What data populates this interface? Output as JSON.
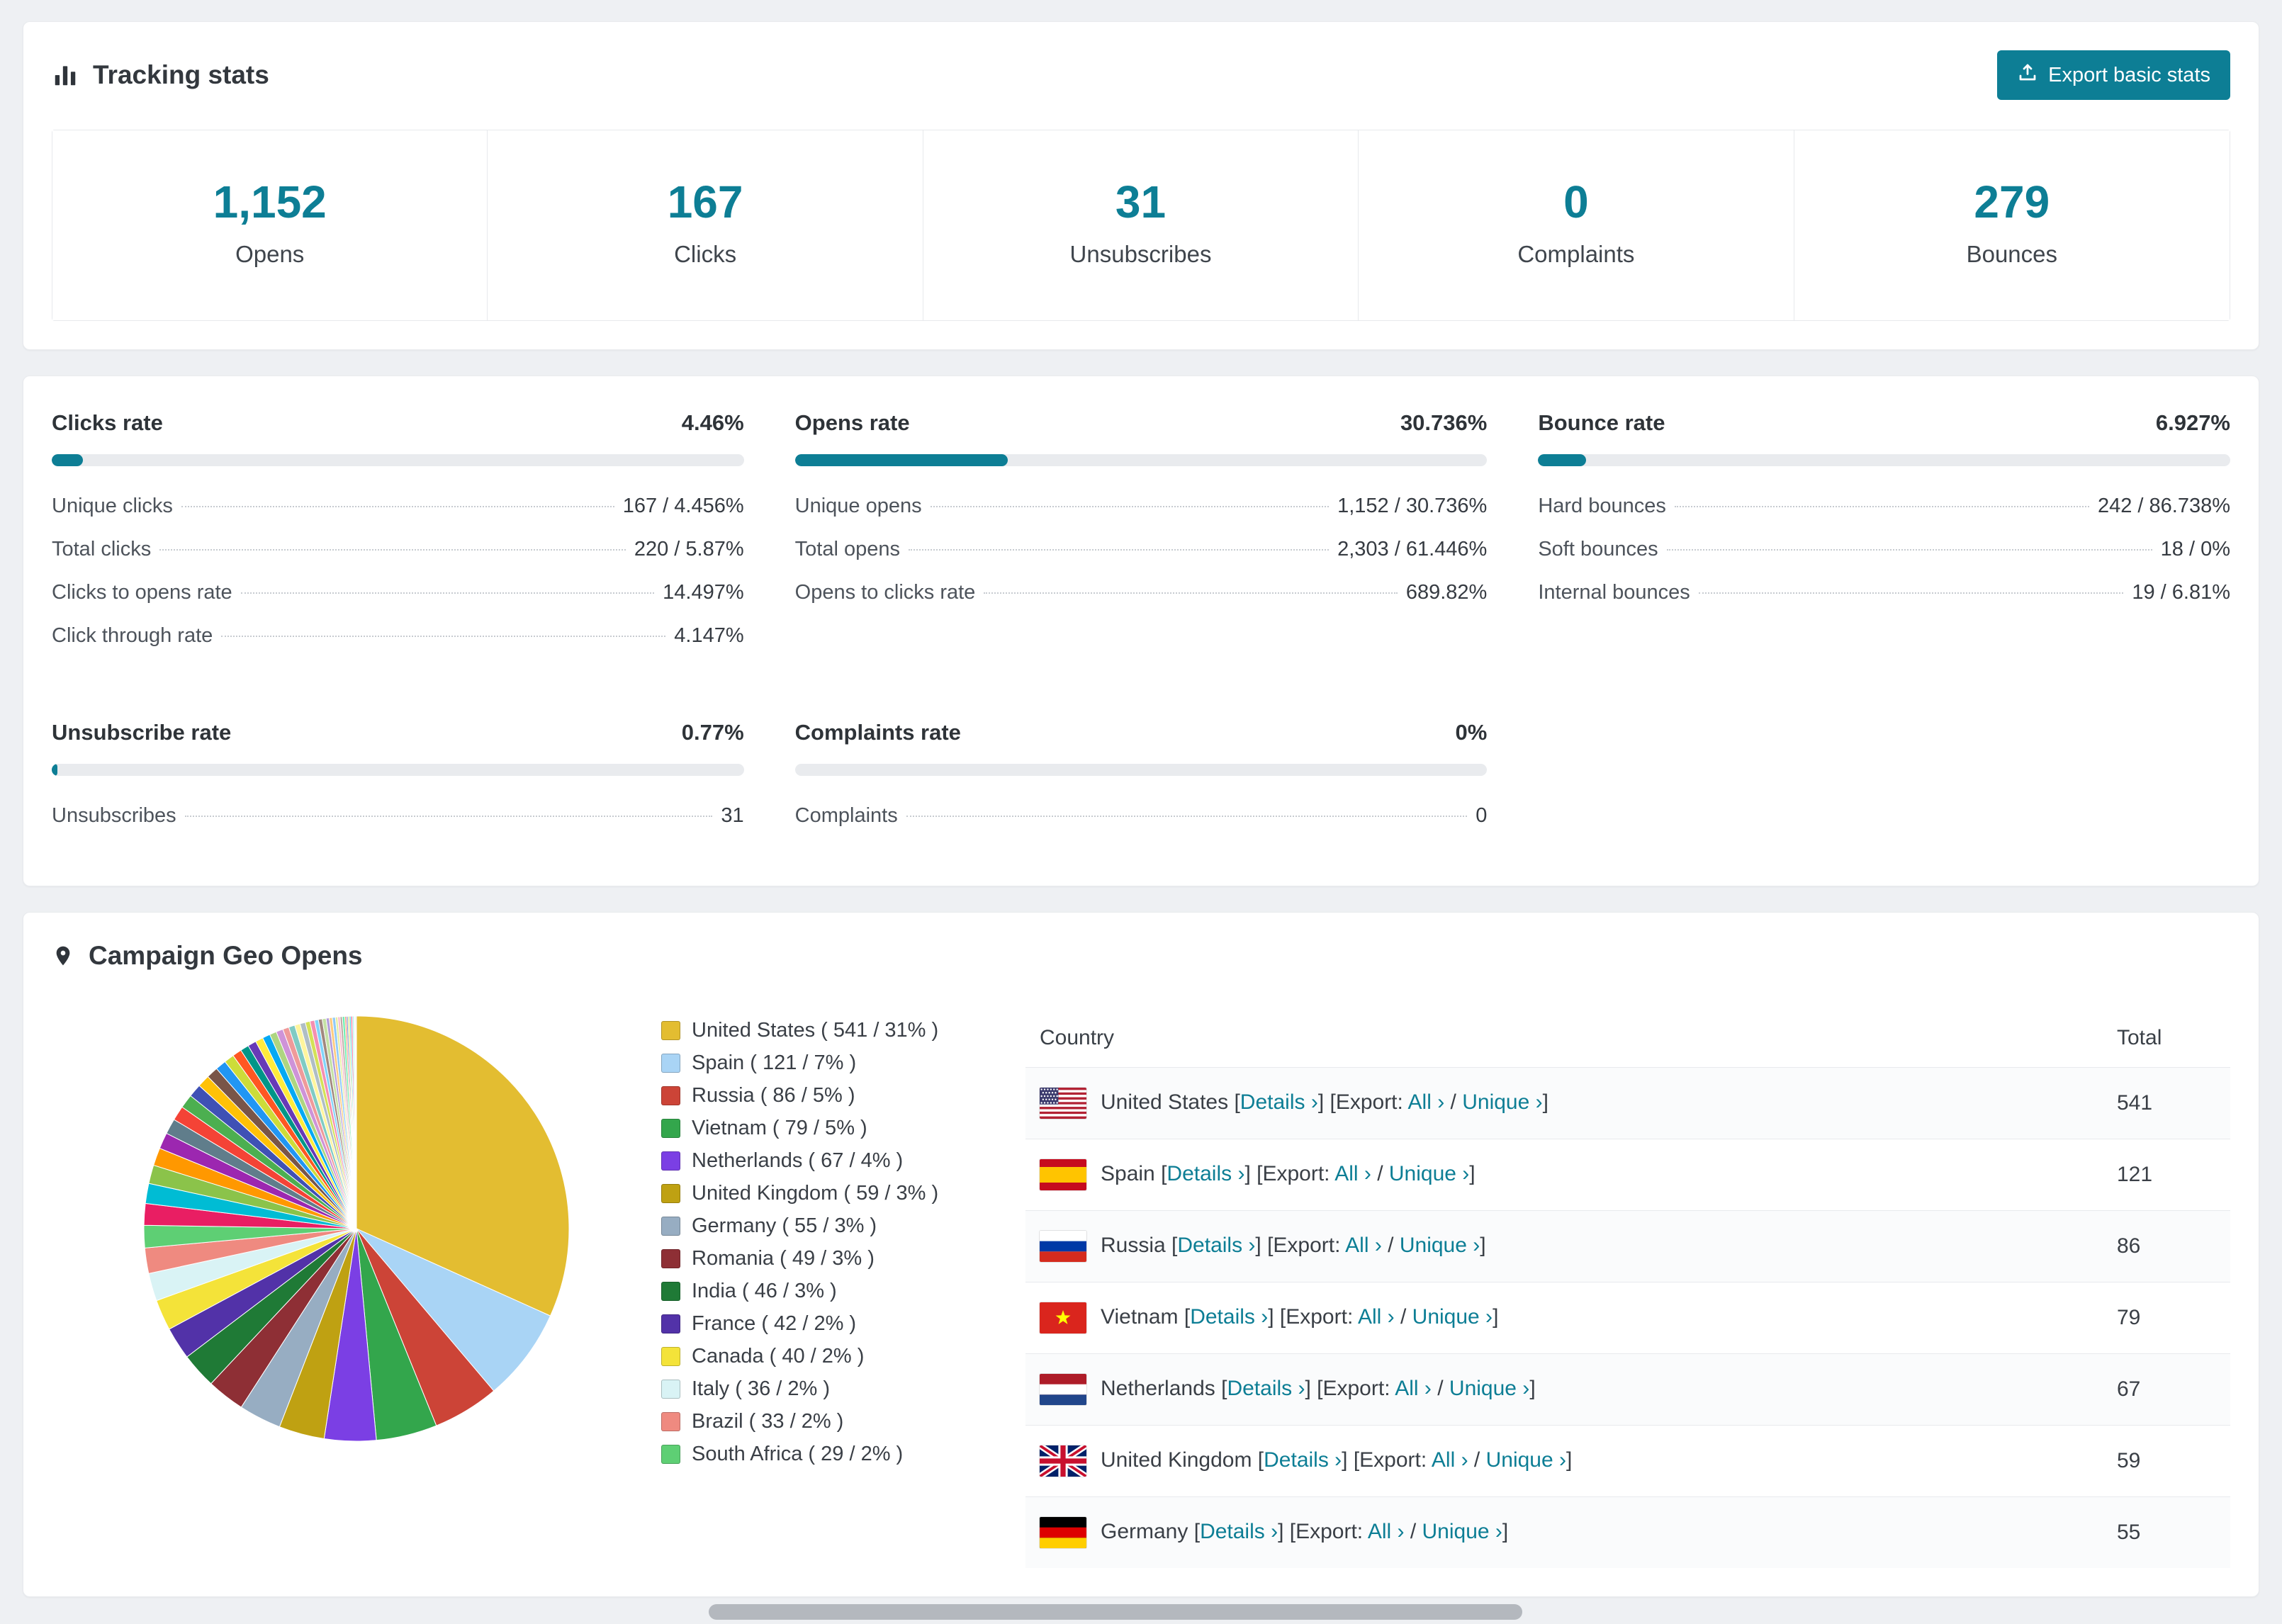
{
  "colors": {
    "accent": "#0d7e95",
    "page_bg": "#eef0f3",
    "progress_track": "#e9ebee"
  },
  "tracking": {
    "title": "Tracking stats",
    "export_button": "Export basic stats",
    "stats": [
      {
        "value": "1,152",
        "label": "Opens"
      },
      {
        "value": "167",
        "label": "Clicks"
      },
      {
        "value": "31",
        "label": "Unsubscribes"
      },
      {
        "value": "0",
        "label": "Complaints"
      },
      {
        "value": "279",
        "label": "Bounces"
      }
    ]
  },
  "rate_panels": [
    {
      "title": "Clicks rate",
      "value": "4.46%",
      "percent": 4.46,
      "rows": [
        {
          "label": "Unique clicks",
          "value": "167 / 4.456%"
        },
        {
          "label": "Total clicks",
          "value": "220 / 5.87%"
        },
        {
          "label": "Clicks to opens rate",
          "value": "14.497%"
        },
        {
          "label": "Click through rate",
          "value": "4.147%"
        }
      ]
    },
    {
      "title": "Opens rate",
      "value": "30.736%",
      "percent": 30.736,
      "rows": [
        {
          "label": "Unique opens",
          "value": "1,152 / 30.736%"
        },
        {
          "label": "Total opens",
          "value": "2,303 / 61.446%"
        },
        {
          "label": "Opens to clicks rate",
          "value": "689.82%"
        }
      ]
    },
    {
      "title": "Bounce rate",
      "value": "6.927%",
      "percent": 6.927,
      "rows": [
        {
          "label": "Hard bounces",
          "value": "242 / 86.738%"
        },
        {
          "label": "Soft bounces",
          "value": "18 / 0%"
        },
        {
          "label": "Internal bounces",
          "value": "19 / 6.81%"
        }
      ]
    },
    {
      "title": "Unsubscribe rate",
      "value": "0.77%",
      "percent": 0.77,
      "rows": [
        {
          "label": "Unsubscribes",
          "value": "31"
        }
      ]
    },
    {
      "title": "Complaints rate",
      "value": "0%",
      "percent": 0,
      "rows": [
        {
          "label": "Complaints",
          "value": "0"
        }
      ]
    }
  ],
  "geo": {
    "title": "Campaign Geo Opens",
    "table_headers": {
      "country": "Country",
      "total": "Total"
    },
    "link_labels": {
      "details": "Details ›",
      "export": "Export:",
      "all": "All ›",
      "unique": "Unique ›"
    },
    "rows": [
      {
        "country": "United States",
        "flag": "us",
        "total": "541"
      },
      {
        "country": "Spain",
        "flag": "es",
        "total": "121"
      },
      {
        "country": "Russia",
        "flag": "ru",
        "total": "86"
      },
      {
        "country": "Vietnam",
        "flag": "vn",
        "total": "79"
      },
      {
        "country": "Netherlands",
        "flag": "nl",
        "total": "67"
      },
      {
        "country": "United Kingdom",
        "flag": "gb",
        "total": "59"
      },
      {
        "country": "Germany",
        "flag": "de",
        "total": "55"
      }
    ]
  },
  "chart_data": {
    "type": "pie",
    "title": "Campaign Geo Opens",
    "legend_position": "right",
    "labels": [
      "United States",
      "Spain",
      "Russia",
      "Vietnam",
      "Netherlands",
      "United Kingdom",
      "Germany",
      "Romania",
      "India",
      "France",
      "Canada",
      "Italy",
      "Brazil",
      "South Africa"
    ],
    "values": [
      541,
      121,
      86,
      79,
      67,
      59,
      55,
      49,
      46,
      42,
      40,
      36,
      33,
      29
    ],
    "percents": [
      31,
      7,
      5,
      5,
      4,
      3,
      3,
      3,
      3,
      2,
      2,
      2,
      2,
      2
    ],
    "colors": [
      "#e3bd31",
      "#a9d4f5",
      "#cc4437",
      "#33a64c",
      "#7b3fe4",
      "#bfa112",
      "#97adc2",
      "#8e2f35",
      "#1f7a36",
      "#5232a8",
      "#f4e339",
      "#d9f3f5",
      "#ef8a80",
      "#5ecf74"
    ],
    "others": {
      "values": [
        28,
        26,
        24,
        23,
        21,
        20,
        19,
        18,
        17,
        16,
        15,
        14,
        13,
        12,
        11,
        11,
        10,
        10,
        9,
        9,
        8,
        8,
        7,
        7,
        6,
        6,
        5,
        5,
        5,
        4,
        4,
        4,
        3,
        3,
        3,
        3,
        2,
        2,
        2,
        2,
        2,
        2,
        1,
        1,
        1
      ],
      "colors": [
        "#e91e63",
        "#00bcd4",
        "#8bc34a",
        "#ff9800",
        "#9c27b0",
        "#607d8b",
        "#f44336",
        "#4caf50",
        "#3f51b5",
        "#ffc107",
        "#795548",
        "#2196f3",
        "#cddc39",
        "#ff5722",
        "#009688",
        "#673ab7",
        "#ffeb3b",
        "#03a9f4",
        "#aed581",
        "#ce93d8",
        "#ef9a9a",
        "#80cbc4",
        "#fff59d",
        "#b0bec5",
        "#d4e157",
        "#f48fb1",
        "#81d4fa",
        "#a1887f",
        "#c5e1a5",
        "#b39ddb",
        "#ffcc80",
        "#90caf9",
        "#e6ee9c",
        "#f8bbd0",
        "#bcaaa4",
        "#69f0ae",
        "#ff8a65",
        "#7986cb",
        "#dce775",
        "#4dd0e1",
        "#f06292",
        "#a7ffeb",
        "#b388ff",
        "#ffab91",
        "#26a69a"
      ]
    }
  }
}
